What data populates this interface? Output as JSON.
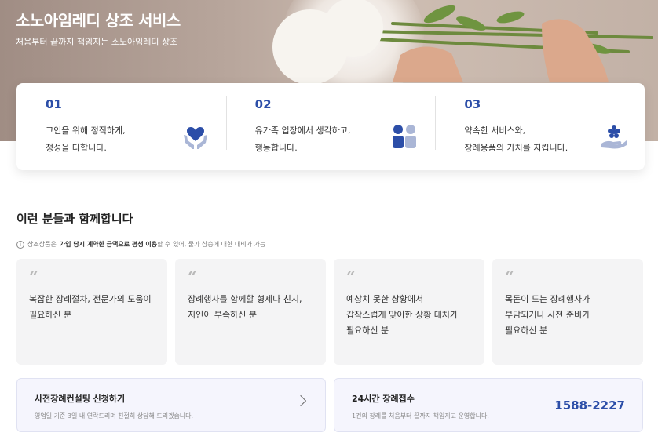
{
  "hero": {
    "title": "소노아임레디 상조 서비스",
    "subtitle": "처음부터 끝까지 책임지는 소노아임레디 상조"
  },
  "features": [
    {
      "number": "01",
      "text": "고인을 위해 정직하게,\n정성을 다합니다.",
      "icon": "heart-hands-icon"
    },
    {
      "number": "02",
      "text": "유가족 입장에서 생각하고,\n행동합니다.",
      "icon": "people-icon"
    },
    {
      "number": "03",
      "text": "약속한 서비스와,\n장례용품의 가치를 지킵니다.",
      "icon": "flower-hand-icon"
    }
  ],
  "audience": {
    "title": "이런 분들과 함께합니다",
    "note_prefix": "상조상품은",
    "note_bold": "가입 당시 계약한 금액으로 평생 이용",
    "note_suffix": "할 수 있어, 물가 상승에 대한 대비가 가능",
    "quote_mark": "“",
    "cards": [
      {
        "text": "복잡한 장례절차, 전문가의 도움이\n필요하신 분"
      },
      {
        "text": "장례행사를 함께할 형제나 친지,\n지인이 부족하신 분"
      },
      {
        "text": "예상치 못한 상황에서\n갑작스럽게 맞이한 상황 대처가\n필요하신 분"
      },
      {
        "text": "목돈이 드는 장례행사가\n부담되거나 사전 준비가\n필요하신 분"
      }
    ]
  },
  "consulting": {
    "title": "사전장례컨설팅 신청하기",
    "subtitle": "영업일 기준 3일 내 연락드리며 친절히 상담해 드리겠습니다."
  },
  "reception": {
    "title": "24시간 장례접수",
    "subtitle": "1건의 장례를 처음부터 끝까지 책임지고 운영합니다.",
    "phone": "1588-2227"
  },
  "colors": {
    "accent": "#2c4ea8",
    "icon_light": "#aab6d6"
  }
}
